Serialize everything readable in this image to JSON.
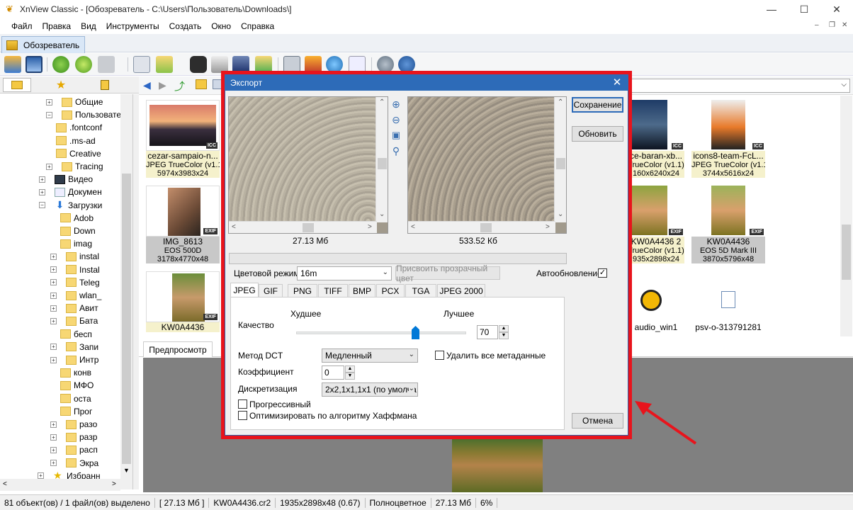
{
  "window": {
    "title": "XnView Classic - [Обозреватель - C:\\Users\\Пользователь\\Downloads\\]"
  },
  "menu": [
    "Файл",
    "Правка",
    "Вид",
    "Инструменты",
    "Создать",
    "Окно",
    "Справка"
  ],
  "doc_tab": "Обозреватель",
  "tree": {
    "items": [
      {
        "label": "Общие",
        "type": "folder"
      },
      {
        "label": "Пользовател",
        "type": "folder"
      },
      {
        "label": ".fontconf",
        "type": "folder"
      },
      {
        "label": ".ms-ad",
        "type": "folder"
      },
      {
        "label": "Creative",
        "type": "folder"
      },
      {
        "label": "Tracing",
        "type": "folder"
      },
      {
        "label": "Видео",
        "type": "video"
      },
      {
        "label": "Докумен",
        "type": "doc"
      },
      {
        "label": "Загрузки",
        "type": "download"
      },
      {
        "label": "Adob",
        "type": "folder"
      },
      {
        "label": "Down",
        "type": "folder"
      },
      {
        "label": "imag",
        "type": "folder"
      },
      {
        "label": "instal",
        "type": "folder"
      },
      {
        "label": "Instal",
        "type": "folder"
      },
      {
        "label": "Teleg",
        "type": "folder"
      },
      {
        "label": "wlan_",
        "type": "folder"
      },
      {
        "label": "Авит",
        "type": "folder"
      },
      {
        "label": "Бата",
        "type": "folder"
      },
      {
        "label": "бесп",
        "type": "folder"
      },
      {
        "label": "Запи",
        "type": "folder"
      },
      {
        "label": "Интр",
        "type": "folder"
      },
      {
        "label": "конв",
        "type": "folder"
      },
      {
        "label": "МФО",
        "type": "folder"
      },
      {
        "label": "оста",
        "type": "folder"
      },
      {
        "label": "Прог",
        "type": "folder"
      },
      {
        "label": "разо",
        "type": "folder"
      },
      {
        "label": "разр",
        "type": "folder"
      },
      {
        "label": "расп",
        "type": "folder"
      },
      {
        "label": "Экра",
        "type": "folder"
      },
      {
        "label": "Избранн",
        "type": "star"
      }
    ]
  },
  "thumbnails": [
    {
      "name": "cezar-sampaio-n...",
      "format": "JPEG TrueColor (v1.1)",
      "dims": "5974x3983x24",
      "badge": "ICC"
    },
    {
      "name": "IMG_8613",
      "format": "EOS 500D",
      "dims": "3178x4770x48",
      "badge": "EXIF"
    },
    {
      "name": "KW0A4436",
      "format": "",
      "dims": "",
      "badge": "EXIF"
    },
    {
      "name": "ce-baran-xb...",
      "format": "TrueColor (v1.1)",
      "dims": "160x6240x24",
      "badge": "ICC"
    },
    {
      "name": "icons8-team-FcL...",
      "format": "JPEG TrueColor (v1.1)",
      "dims": "3744x5616x24",
      "badge": "ICC"
    },
    {
      "name": "KW0A4436 2",
      "format": "TrueColor (v1.1)",
      "dims": "935x2898x24",
      "badge": "EXIF"
    },
    {
      "name": "KW0A4436",
      "format": "EOS 5D Mark III",
      "dims": "3870x5796x48",
      "badge": "EXIF"
    },
    {
      "name": "audio_win1",
      "format": "",
      "dims": "",
      "badge": ""
    },
    {
      "name": "psv-o-313791281",
      "format": "",
      "dims": "",
      "badge": ""
    }
  ],
  "preview_tab": "Предпросмотр",
  "status": [
    "81 объект(ов) / 1 файл(ов) выделено",
    "[ 27.13 Мб ]",
    "KW0A4436.cr2",
    "1935x2898x48 (0.67)",
    "Полноцветное",
    "27.13 Мб",
    "6%"
  ],
  "dialog": {
    "title": "Экспорт",
    "original_size": "27.13 Мб",
    "export_size": "533.52 Кб",
    "save_button": "Сохранение",
    "refresh_button": "Обновить",
    "cancel_button": "Отмена",
    "color_mode_label": "Цветовой режим",
    "color_mode_value": "16m",
    "assign_transparent_button": "Присвоить прозрачный цвет",
    "autoupdate_label": "Автообновление",
    "autoupdate_checked": true,
    "format_tabs": [
      "JPEG",
      "GIF",
      "PNG",
      "TIFF",
      "BMP",
      "PCX",
      "TGA",
      "JPEG 2000"
    ],
    "active_tab": "JPEG",
    "quality": {
      "label": "Качество",
      "worse": "Худшее",
      "better": "Лучшее",
      "value": 70
    },
    "dct_label": "Метод DCT",
    "dct_value": "Медленный",
    "remove_metadata_label": "Удалить все метаданные",
    "remove_metadata_checked": false,
    "coef_label": "Коэффициент",
    "coef_value": "0",
    "sampling_label": "Дискретизация",
    "sampling_value": "2x2,1x1,1x1 (по умолча",
    "progressive_label": "Прогрессивный",
    "progressive_checked": false,
    "huffman_label": "Оптимизировать по алгоритму Хаффмана",
    "huffman_checked": false
  },
  "colors": {
    "highlight": "#e8141c",
    "dialog_title": "#2d6bb8"
  }
}
